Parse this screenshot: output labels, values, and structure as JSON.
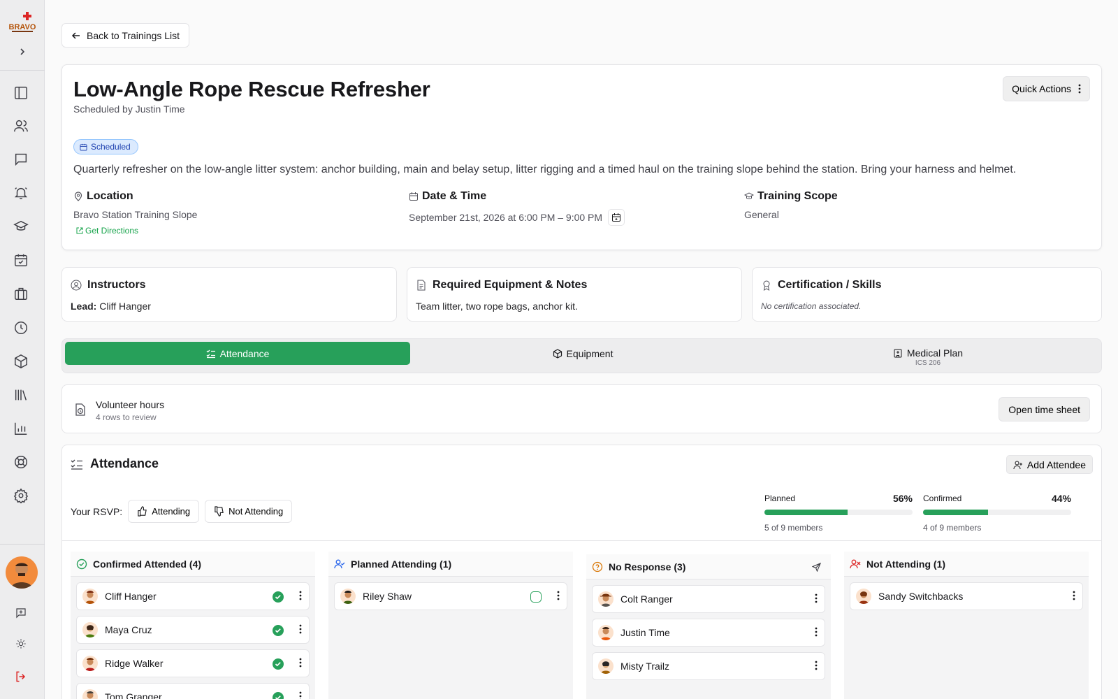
{
  "sidebar": {
    "logo_text": "BRAVO",
    "icons": [
      "panel-icon",
      "users-icon",
      "messages-icon",
      "alert-bell-icon",
      "graduation-cap-icon",
      "calendar-check-icon",
      "briefcase-icon",
      "clock-icon",
      "package-icon",
      "library-icon",
      "bar-chart-icon",
      "lifebuoy-icon",
      "settings-icon"
    ],
    "footer_icons": [
      "feedback-icon",
      "theme-sun-icon",
      "logout-icon"
    ]
  },
  "back_label": "Back to Trainings List",
  "training": {
    "title": "Low‑Angle Rope Rescue Refresher",
    "scheduled_by": "Scheduled by Justin Time",
    "status": "Scheduled",
    "quick_actions": "Quick Actions",
    "description": "Quarterly refresher on the low‑angle litter system: anchor building, main and belay setup, litter rigging and a timed haul on the training slope behind the station. Bring your harness and helmet.",
    "location_label": "Location",
    "location": "Bravo Station Training Slope",
    "directions": "Get Directions",
    "datetime_label": "Date & Time",
    "datetime": "September 21st, 2026 at 6:00 PM – 9:00 PM",
    "scope_label": "Training Scope",
    "scope": "General"
  },
  "info_cards": {
    "instructors": {
      "title": "Instructors",
      "lead_label": "Lead:",
      "lead": "Cliff Hanger"
    },
    "equipment": {
      "title": "Required Equipment & Notes",
      "body": "Team litter, two rope bags, anchor kit."
    },
    "certification": {
      "title": "Certification / Skills",
      "body": "No certification associated."
    }
  },
  "tabs": [
    {
      "label": "Attendance",
      "sub": ""
    },
    {
      "label": "Equipment",
      "sub": ""
    },
    {
      "label": "Medical Plan",
      "sub": "ICS 206"
    }
  ],
  "hours": {
    "title": "Volunteer hours",
    "sub": "4 rows to review",
    "button": "Open time sheet"
  },
  "attendance": {
    "title": "Attendance",
    "add_button": "Add Attendee",
    "rsvp_label": "Your RSVP:",
    "rsvp_yes": "Attending",
    "rsvp_no": "Not Attending",
    "planned": {
      "label": "Planned",
      "pct_text": "56%",
      "fraction": 0.56,
      "sub": "5 of 9 members"
    },
    "confirmed": {
      "label": "Confirmed",
      "pct_text": "44%",
      "fraction": 0.44,
      "sub": "4 of 9 members"
    },
    "columns": [
      {
        "title": "Confirmed Attended (4)",
        "members": [
          "Cliff Hanger",
          "Maya Cruz",
          "Ridge Walker",
          "Tom Granger"
        ]
      },
      {
        "title": "Planned Attending (1)",
        "members": [
          "Riley Shaw"
        ]
      },
      {
        "title": "No Response (3)",
        "members": [
          "Colt Ranger",
          "Justin Time",
          "Misty Trailz"
        ]
      },
      {
        "title": "Not Attending (1)",
        "members": [
          "Sandy Switchbacks"
        ]
      }
    ]
  },
  "colors": {
    "accent": "#27a05a",
    "badge_bg": "#dbeafe",
    "badge_text": "#1e40af",
    "logout": "#dc2626"
  }
}
